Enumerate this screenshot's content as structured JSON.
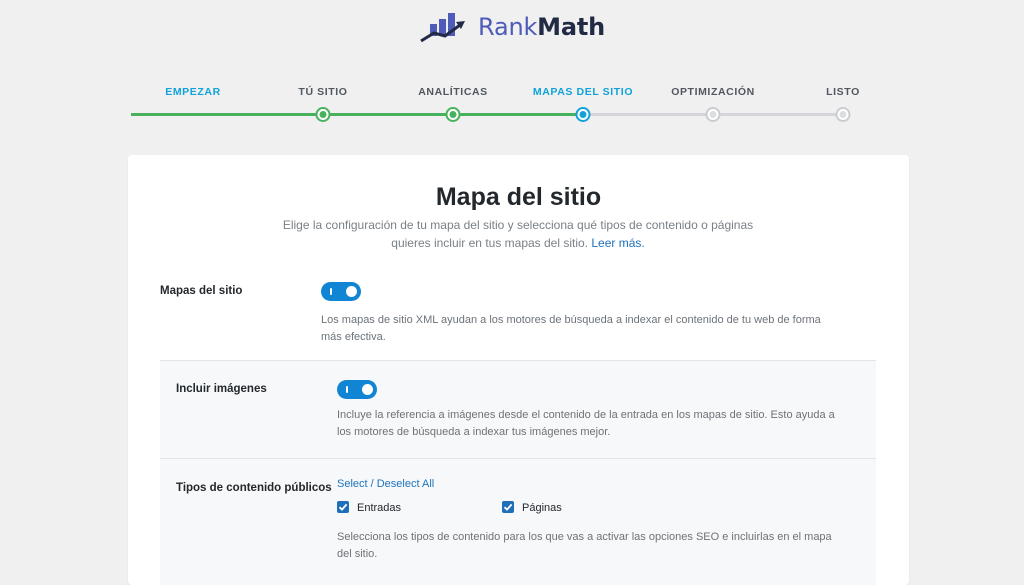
{
  "logo": {
    "part1": "Rank",
    "part2": "Math"
  },
  "steps": [
    {
      "label": "EMPEZAR",
      "state": "done"
    },
    {
      "label": "TÚ SITIO",
      "state": "done"
    },
    {
      "label": "ANALÍTICAS",
      "state": "done"
    },
    {
      "label": "MAPAS DEL SITIO",
      "state": "active"
    },
    {
      "label": "OPTIMIZACIÓN",
      "state": "todo"
    },
    {
      "label": "LISTO",
      "state": "todo"
    }
  ],
  "card": {
    "title": "Mapa del sitio",
    "desc_line1": "Elige la configuración de tu mapa del sitio y selecciona qué tipos de contenido o páginas",
    "desc_line2": "quieres incluir en tus mapas del sitio.",
    "desc_link": "Leer más."
  },
  "sitemaps": {
    "label": "Mapas del sitio",
    "enabled": true,
    "help_line1": "Los mapas de sitio XML ayudan a los motores de búsqueda a indexar el contenido de tu web de forma",
    "help_line2": "más efectiva."
  },
  "images": {
    "label": "Incluir imágenes",
    "enabled": true,
    "help_line1": "Incluye la referencia a imágenes desde el contenido de la entrada en los mapas de sitio. Esto ayuda a",
    "help_line2": "los motores de búsqueda a indexar tus imágenes mejor."
  },
  "post_types": {
    "label": "Tipos de contenido públicos",
    "select_all": "Select / Deselect All",
    "items": [
      {
        "label": "Entradas",
        "checked": true
      },
      {
        "label": "Páginas",
        "checked": true
      }
    ],
    "help_line1": "Selecciona los tipos de contenido para los que vas a activar las opciones SEO e incluirlas en el mapa",
    "help_line2": "del sitio."
  },
  "colors": {
    "accent": "#10a2d9",
    "done": "#47b25b",
    "toggle": "#1085d4",
    "link": "#1e73be"
  }
}
